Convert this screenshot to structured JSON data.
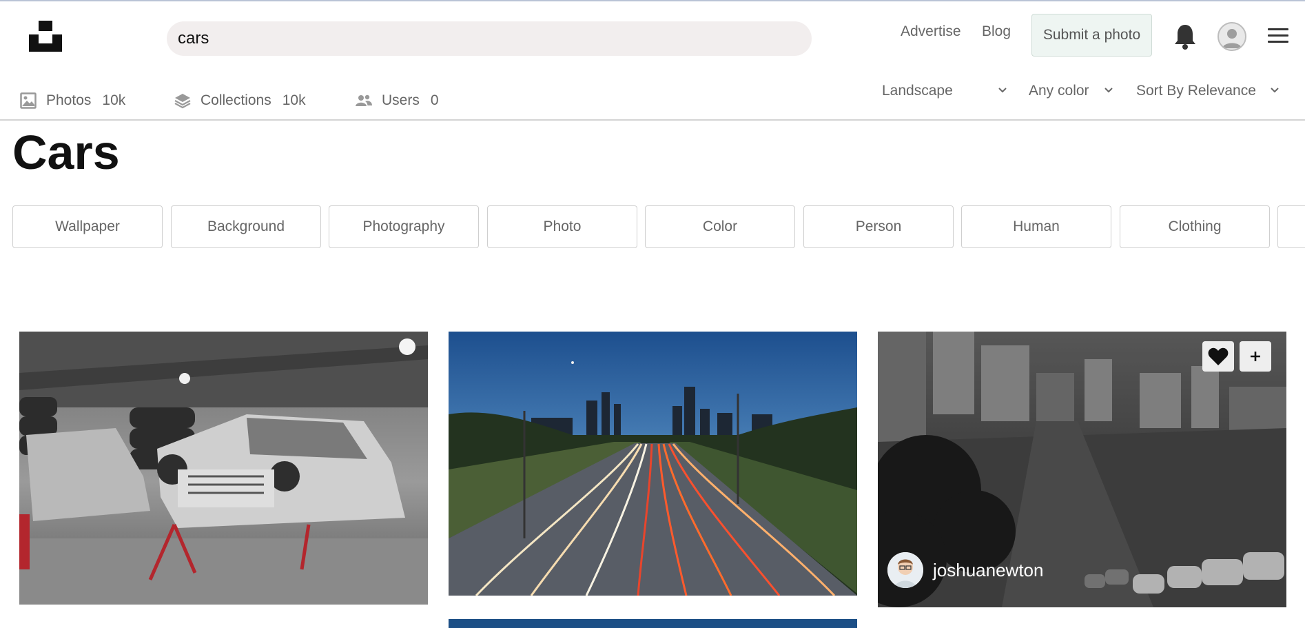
{
  "header": {
    "logo_icon": "unsplash-logo-icon",
    "search_value": "cars",
    "links": [
      "Advertise",
      "Blog"
    ],
    "submit_label": "Submit a photo",
    "bell_icon": "bell-icon",
    "avatar_icon": "user-avatar-icon",
    "menu_icon": "hamburger-menu-icon"
  },
  "tabs": [
    {
      "icon": "image-icon",
      "label": "Photos",
      "count": "10k"
    },
    {
      "icon": "layers-icon",
      "label": "Collections",
      "count": "10k"
    },
    {
      "icon": "users-icon",
      "label": "Users",
      "count": "0"
    }
  ],
  "filters": [
    {
      "label": "Landscape"
    },
    {
      "label": "Any color"
    },
    {
      "label": "Sort By Relevance"
    }
  ],
  "page_title": "Cars",
  "related_tags": [
    "Wallpaper",
    "Background",
    "Photography",
    "Photo",
    "Color",
    "Person",
    "Human",
    "Clothing"
  ],
  "photos": [
    {
      "description": "vintage car body in a garage"
    },
    {
      "description": "highway light trails toward city skyline at dusk"
    },
    {
      "description": "black and white city street on a hill",
      "author": "joshuanewton",
      "like_icon": "heart-icon",
      "add_icon": "plus-icon"
    }
  ],
  "colors": {
    "accent_bg": "#eef5f2",
    "search_bg": "#f2eeee",
    "text_muted": "#666666"
  }
}
